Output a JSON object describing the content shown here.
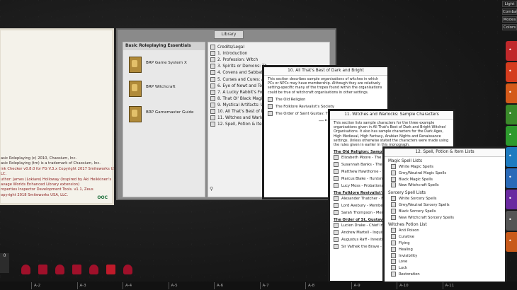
{
  "credits": {
    "lines": [
      {
        "text": "asic Roleplaying (c) 2010, Chaosium, Inc.",
        "red": false
      },
      {
        "text": "asic Roleplaying (tm) is a trademark of Chaosium, Inc.",
        "red": false
      },
      {
        "text": "ink Checker v0.8.0 for FG V.3.x Copyright 2017 Smiteworks USA",
        "red": true
      },
      {
        "text": "LC.",
        "red": true
      },
      {
        "text": "uthor: James (Lokiare) Holloway (Inspired by Aki Heikkinen's",
        "red": true
      },
      {
        "text": "avage Worlds Enhanced Library extension)",
        "red": true
      },
      {
        "text": "roperties Inspector Development Tools. v1.1, Zeus",
        "red": true
      },
      {
        "text": "opyright 2018 Smiteworks USA, LLC.",
        "red": true
      }
    ],
    "ooc": "OOC"
  },
  "library": {
    "title": "Library",
    "left_header": "Basic Roleplaying Essentials",
    "books": [
      "BRP Game System X",
      "BRP Witchcraft",
      "BRP Gamemaster Guide"
    ],
    "toc": [
      "Credits/Legal",
      "1. Introduction",
      "2. Profession: Witch",
      "3. Spirits or Demons: Th",
      "4. Covens and Sabbats",
      "5. Curses and Cures: A V",
      "6. Eye of Newt and Toe",
      "7. A Lucky Rabbit's Foot",
      "8. That Ol' Black Magic",
      "9. Mystical Artifacts: Un",
      "10. All That's Best of Da",
      "11. Witches and Warlock",
      "12. Spell, Potion & Item"
    ]
  },
  "story10": {
    "title": "10. All That's Best of Dark and Bright",
    "text": "This section describes sample organisations of witches in which PCs or NPCs may have membership. Although they are relatively setting-specific many of the tropes found within the organisations could be true of witchcraft organisations in other settings.",
    "links": [
      "The Old Religion",
      "The Folklore Revivalist's Society",
      "The Order of Saint Gustav: The"
    ]
  },
  "story11": {
    "title": "11. Witches and Warlocks: Sample Characters",
    "text": "This section lists sample characters for the three example organisations given in All That's Best of Dark and Bright Witches' Organisations. It also has sample characters for the Dark Ages, High Medieval, High Fantasy, Arabian Nights and Renaissance settings. Unless otherwise stated the characters were made using the rules given in earlier in this monograph.",
    "groups": [
      {
        "heading": "The Old Religion: Sample Ch",
        "items": [
          "Elizabeth Moore - The C",
          "Susannah Banks - The La",
          "Matthew Hawthorne - Th",
          "Marcus Blake - Huntsman",
          "Lucy Moss - Probationar"
        ]
      },
      {
        "heading": "The Folklore Revivalist's Society",
        "items": [
          "Alexander Thatcher - Fo",
          "Lord Avebury - Membe Circle",
          "Sarah Thompson - Men"
        ]
      },
      {
        "heading": "The Order of St. Gustav: Sam",
        "items": [
          "Lucien Drake - Chief Inv",
          "Andrew Martell - Inquisi",
          "Augustus Raff - Investig",
          "Sir Vathek the Brave - Ex"
        ]
      }
    ]
  },
  "story12": {
    "title": "12. Spell, Potion & Item Lists",
    "sections": [
      {
        "heading": "Magic Spell Lists",
        "items": [
          "White Magic Spells",
          "Grey/Neutral Magic Spells",
          "Black Magic Spells",
          "New Witchcraft Spells"
        ]
      },
      {
        "heading": "Sorcery Spell Lists",
        "items": [
          "White Sorcery Spells",
          "Grey/Neutral Sorcery Spells",
          "Black Sorcery Spells",
          "New Witchcraft Sorcery Spells"
        ]
      },
      {
        "heading": "Witches Potion List",
        "items": [
          "Anti Poison",
          "Curative",
          "Flying",
          "Healing",
          "Invisibility",
          "Love",
          "Luck",
          "Restoration"
        ]
      }
    ]
  },
  "toolbar": {
    "buttons": [
      "Light",
      "Combat",
      "Modes",
      "Colors"
    ]
  },
  "sidetabs": [
    {
      "color": "#c0282b",
      "icon": "d-icon"
    },
    {
      "color": "#d43c1e",
      "icon": "book-icon"
    },
    {
      "color": "#d45a1a",
      "icon": "pencil-icon"
    },
    {
      "color": "#3a8a2a",
      "icon": "check-icon"
    },
    {
      "color": "#2d9a2d",
      "icon": "check2-icon"
    },
    {
      "color": "#1e7bc0",
      "icon": "map-icon"
    },
    {
      "color": "#2a6ab8",
      "icon": "list-icon"
    },
    {
      "color": "#6a2aa0",
      "icon": "people-icon"
    },
    {
      "color": "#555555",
      "icon": "gear-icon"
    },
    {
      "color": "#c85a1a",
      "icon": "tool-icon"
    }
  ],
  "hotkeys": [
    "A-2",
    "A-3",
    "A-4",
    "A-5",
    "A-6",
    "A-7",
    "A-8",
    "A-9",
    "A-10",
    "A-11"
  ],
  "dice": [
    "d4",
    "d6",
    "d8",
    "d10",
    "d12",
    "d20",
    "d100"
  ],
  "chat_count": "0"
}
